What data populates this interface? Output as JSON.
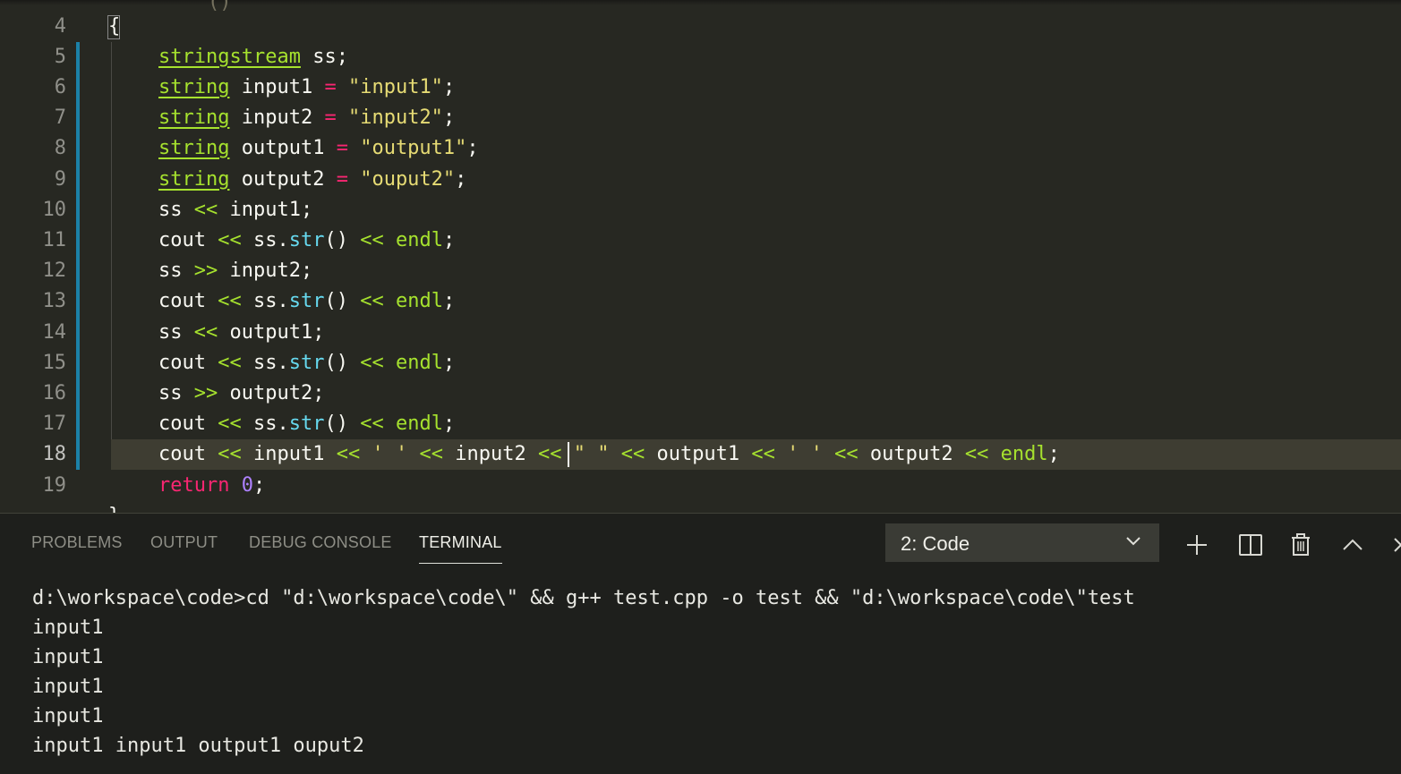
{
  "editor": {
    "peek_text": "()",
    "lines": [
      {
        "n": "4"
      },
      {
        "n": "5"
      },
      {
        "n": "6"
      },
      {
        "n": "7"
      },
      {
        "n": "8"
      },
      {
        "n": "9"
      },
      {
        "n": "10"
      },
      {
        "n": "11"
      },
      {
        "n": "12"
      },
      {
        "n": "13"
      },
      {
        "n": "14"
      },
      {
        "n": "15"
      },
      {
        "n": "16"
      },
      {
        "n": "17"
      },
      {
        "n": "18"
      },
      {
        "n": "19"
      }
    ],
    "open_brace": "{",
    "close_brace_partial": "}",
    "tokens": {
      "stringstream": "stringstream",
      "string": "string",
      "ss": "ss",
      "input1": "input1",
      "input2": "input2",
      "output1": "output1",
      "output2": "output2",
      "cout": "cout",
      "endl": "endl",
      "str": "str",
      "return": "return",
      "zero": "0",
      "str_input1": "\"input1\"",
      "str_input2": "\"input2\"",
      "str_output1": "\"output1\"",
      "str_ouput2": "\"ouput2\"",
      "char_space": "' '",
      "str_space": "\" \""
    }
  },
  "panel": {
    "tabs": [
      "PROBLEMS",
      "OUTPUT",
      "DEBUG CONSOLE",
      "TERMINAL"
    ],
    "active_tab": "TERMINAL",
    "terminal_selector": "2: Code",
    "terminal_lines": [
      "d:\\workspace\\code>cd \"d:\\workspace\\code\\\" && g++ test.cpp -o test && \"d:\\workspace\\code\\\"test",
      "input1",
      "input1",
      "input1",
      "input1",
      "input1 input1 output1 ouput2"
    ]
  },
  "colors": {
    "editor_bg": "#272822",
    "panel_bg": "#1e1f1c",
    "keyword": "#f92672",
    "type": "#a6e22e",
    "string": "#e6db74",
    "function": "#66d9ef",
    "number": "#ae81ff",
    "git_modified": "#1b81a8"
  }
}
